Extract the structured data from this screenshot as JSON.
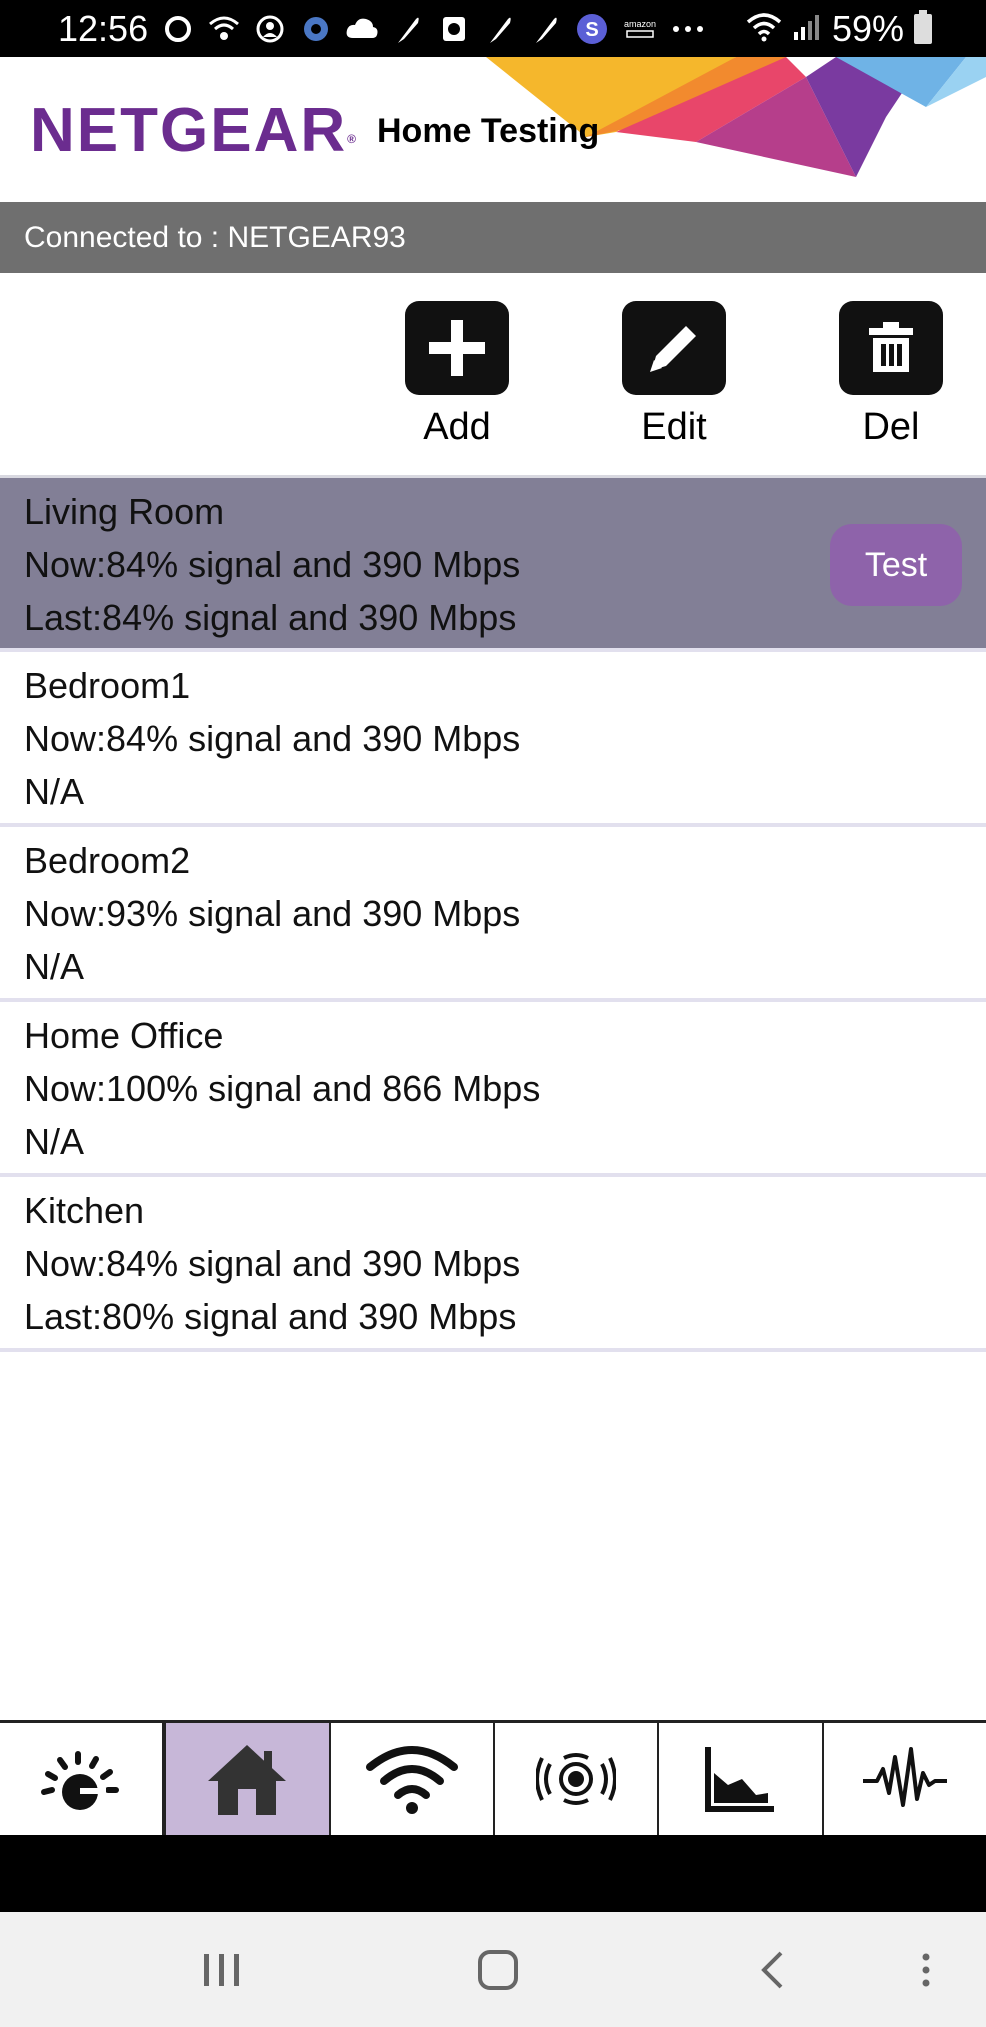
{
  "status_bar": {
    "time": "12:56",
    "battery": "59%",
    "icons": [
      "circle-icon",
      "wifi-calling-icon",
      "account-icon",
      "g-settings-icon",
      "cloud-upload-icon",
      "feather-icon",
      "clock-icon",
      "feather-icon",
      "feather-icon",
      "s-app-icon",
      "amazon-icon",
      "more-dots-icon",
      "wifi-icon",
      "cell-signal-icon",
      "battery-icon"
    ],
    "amazon_label": "amazon"
  },
  "header": {
    "logo": "NETGEAR",
    "logo_mark": "®",
    "title": "Home Testing"
  },
  "connection": {
    "text": "Connected to : NETGEAR93"
  },
  "toolbar": {
    "add_label": "Add",
    "edit_label": "Edit",
    "del_label": "Del"
  },
  "rooms": [
    {
      "name": "Living Room",
      "now": "Now:84% signal and 390 Mbps",
      "last": "Last:84% signal and 390 Mbps",
      "selected": true
    },
    {
      "name": "Bedroom1",
      "now": "Now:84% signal and 390 Mbps",
      "last": "N/A",
      "selected": false
    },
    {
      "name": "Bedroom2",
      "now": "Now:93% signal and 390 Mbps",
      "last": "N/A",
      "selected": false
    },
    {
      "name": "Home Office",
      "now": "Now:100% signal and 866 Mbps",
      "last": "N/A",
      "selected": false
    },
    {
      "name": "Kitchen",
      "now": "Now:84% signal and 390 Mbps",
      "last": "Last:80% signal and 390 Mbps",
      "selected": false
    }
  ],
  "test_button_label": "Test",
  "bottom_nav": {
    "tabs": [
      "speedometer-icon",
      "home-icon",
      "wifi-icon",
      "signal-broadcast-icon",
      "area-chart-icon",
      "waveform-icon"
    ],
    "active_index": 1
  },
  "colors": {
    "brand_purple": "#6b2c8f",
    "selected_row": "#827f96",
    "test_button": "#8e63aa",
    "active_tab": "#c7b7d8",
    "connection_bar": "#6f6f6f"
  }
}
